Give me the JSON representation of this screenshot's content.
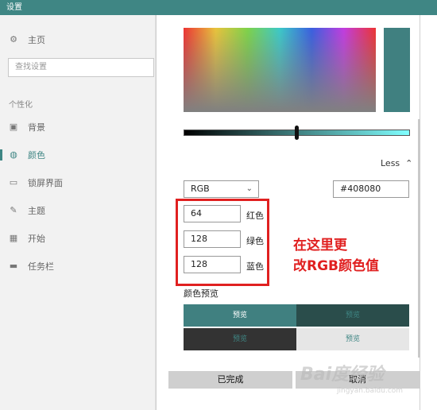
{
  "window": {
    "title": "设置"
  },
  "sidebar": {
    "home": "主页",
    "search_placeholder": "查找设置",
    "section": "个性化",
    "items": [
      {
        "label": "背景",
        "icon": "picture-icon"
      },
      {
        "label": "颜色",
        "icon": "palette-icon"
      },
      {
        "label": "锁屏界面",
        "icon": "lock-screen-icon"
      },
      {
        "label": "主题",
        "icon": "theme-icon"
      },
      {
        "label": "开始",
        "icon": "start-icon"
      },
      {
        "label": "任务栏",
        "icon": "taskbar-icon"
      }
    ],
    "active_item": "颜色"
  },
  "color_picker": {
    "current_color": "#408080",
    "less_label": "Less",
    "mode": "RGB",
    "hex_value": "#408080",
    "channels": [
      {
        "value": "64",
        "label": "红色"
      },
      {
        "value": "128",
        "label": "绿色"
      },
      {
        "value": "128",
        "label": "蓝色"
      }
    ],
    "brightness_level": 0.5
  },
  "annotation": {
    "line1": "在这里更",
    "line2": "改RGB颜色值"
  },
  "preview": {
    "title": "颜色预览",
    "cells": [
      {
        "label": "预览",
        "bg": "#408080",
        "fg": "#ffffff"
      },
      {
        "label": "预览",
        "bg": "#2a4d4b",
        "fg": "#3f8684"
      },
      {
        "label": "预览",
        "bg": "#333333",
        "fg": "#3f8684"
      },
      {
        "label": "预览",
        "bg": "#e6e6e6",
        "fg": "#3f8684"
      }
    ]
  },
  "buttons": {
    "done": "已完成",
    "cancel": "取消"
  },
  "watermark": {
    "text": "Bai度经验",
    "url": "jingyan.baidu.com"
  },
  "colors": {
    "accent": "#3f8684",
    "annotation_red": "#e02020"
  }
}
